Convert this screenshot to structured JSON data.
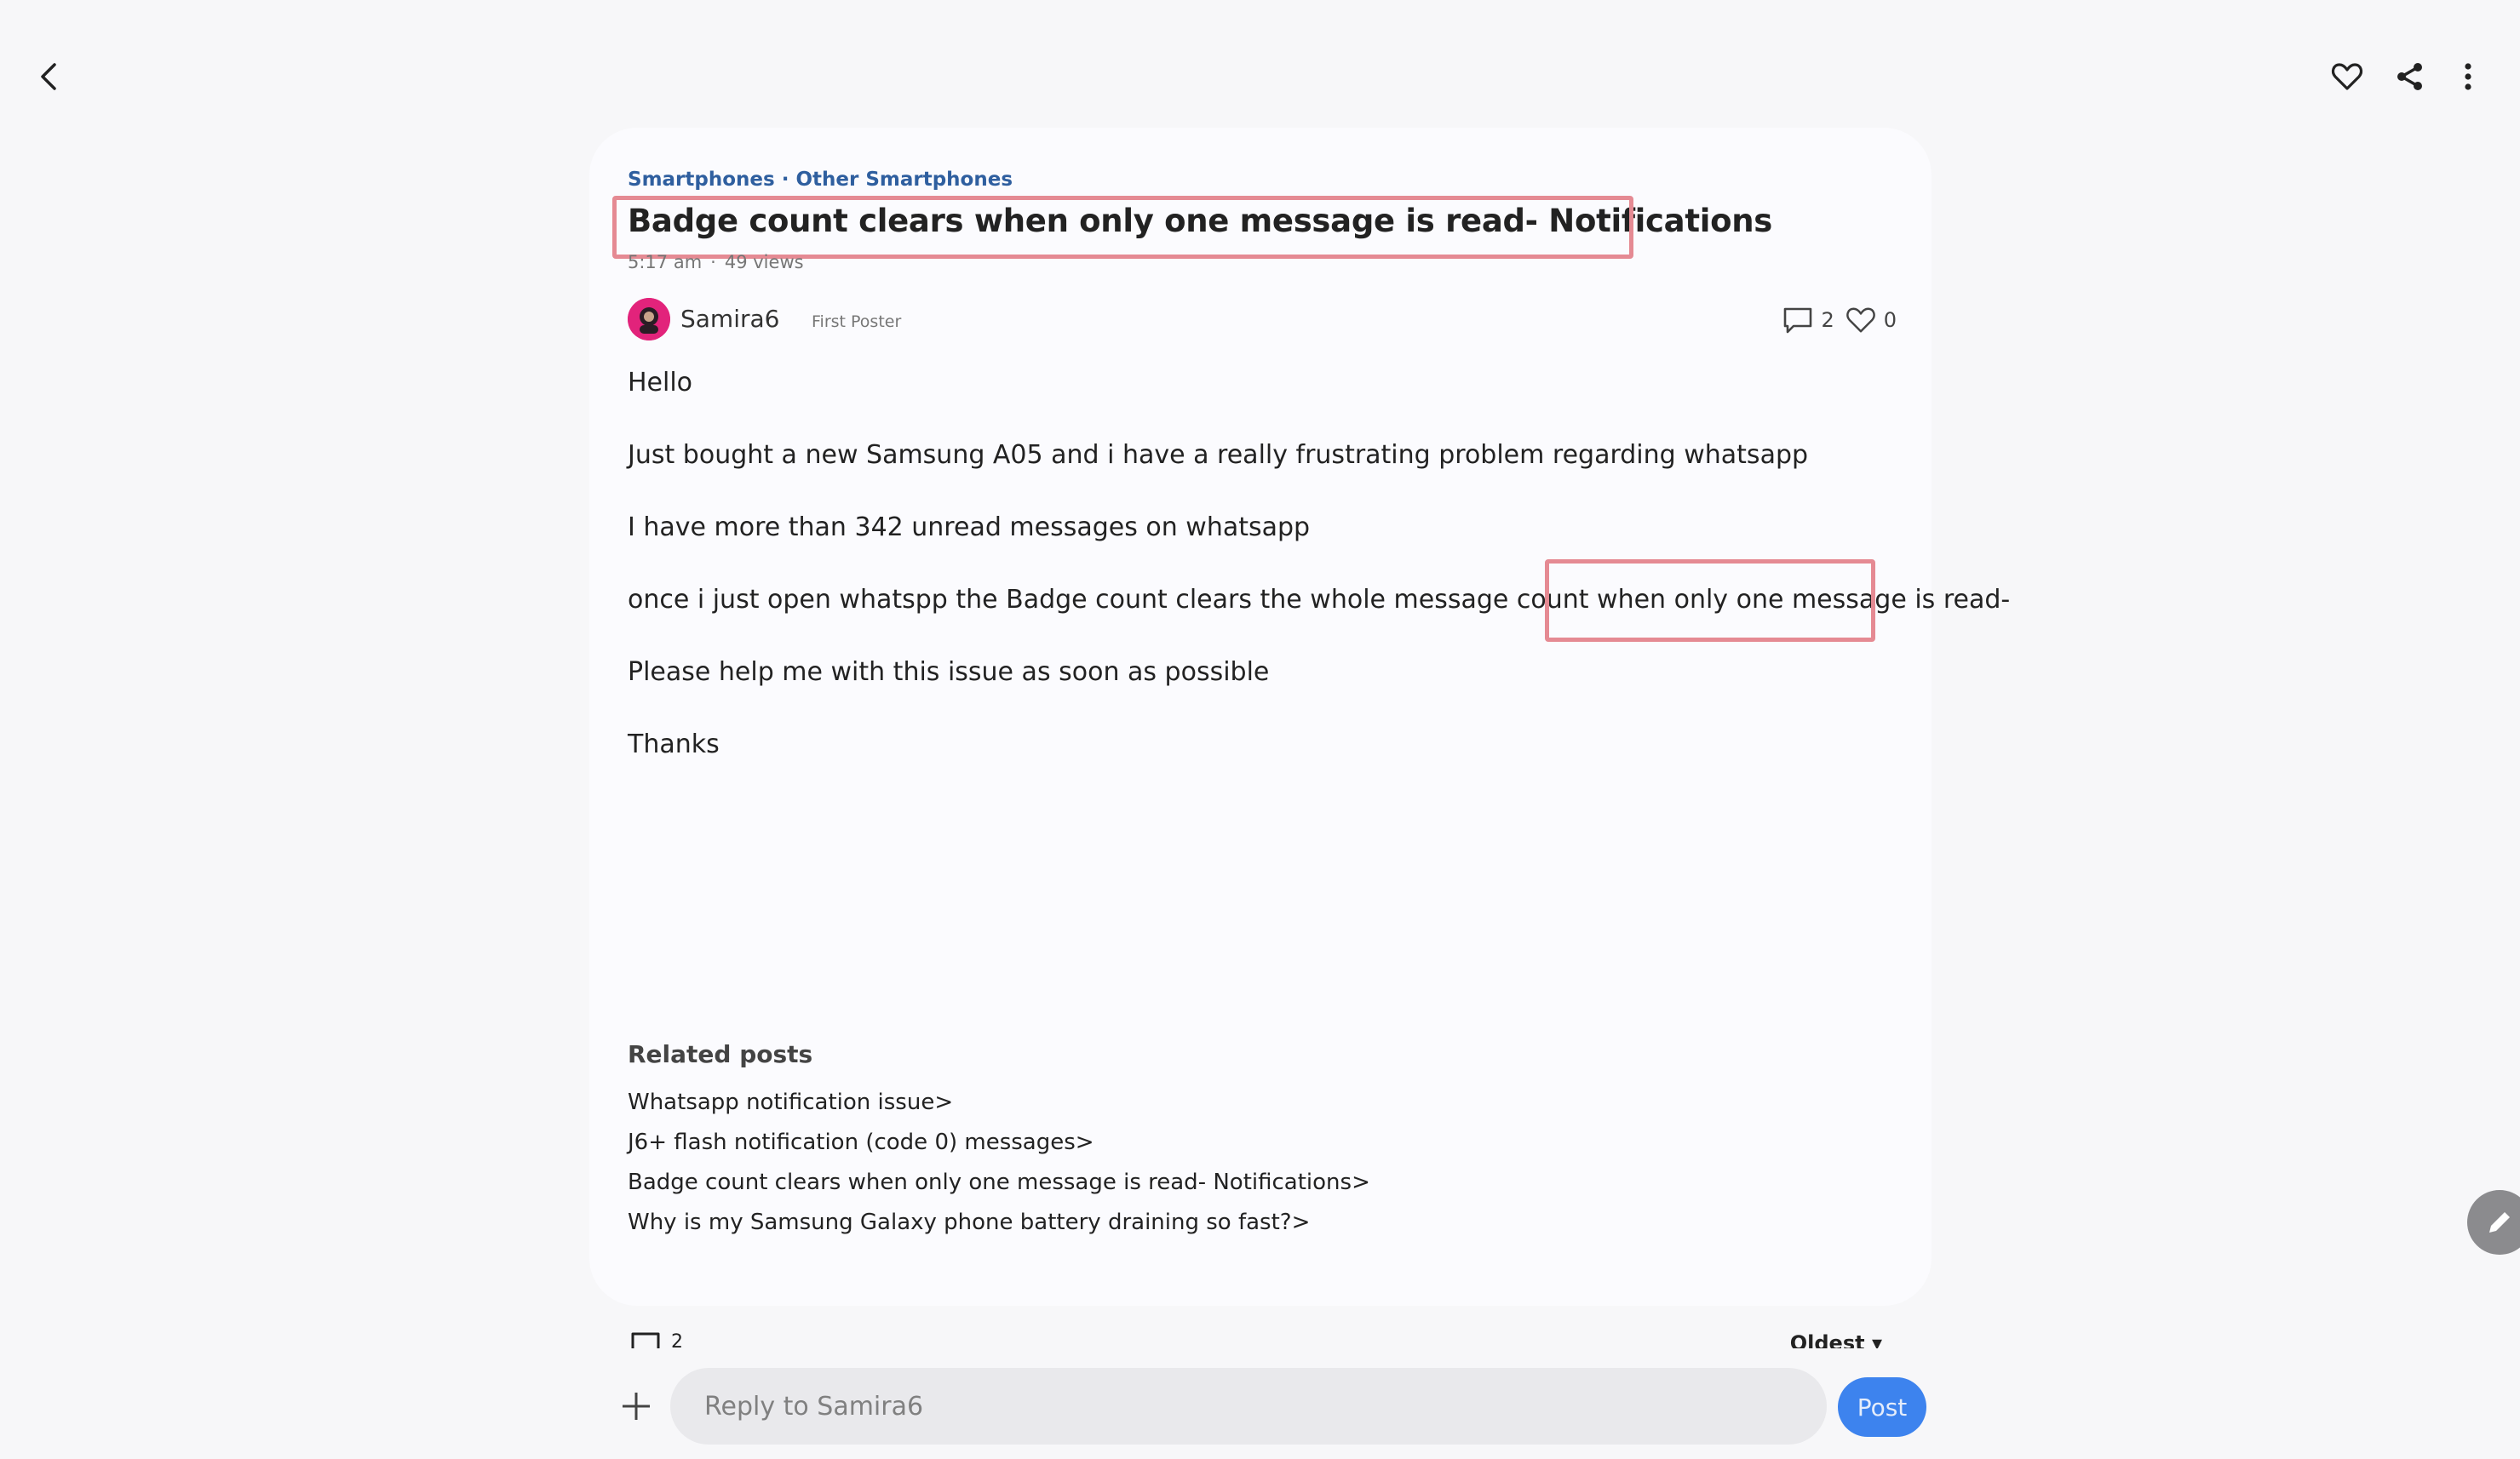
{
  "header": {
    "back_icon": "chevron-left-icon",
    "like_icon": "heart-outline-icon",
    "share_icon": "share-icon",
    "more_icon": "more-vertical-icon"
  },
  "post": {
    "breadcrumb": "Smartphones · Other Smartphones",
    "title": "Badge count clears when only one message is read- Notifications",
    "time": "5:17 am",
    "views": "49 views",
    "author": {
      "name": "Samira6",
      "rank": "First Poster"
    },
    "stats": {
      "comments": "2",
      "likes": "0"
    },
    "body": {
      "greeting": "Hello",
      "line1": "Just bought a new Samsung A05 and i have a really frustrating problem regarding whatsapp",
      "line2": "I have more than 342 unread messages on whatsapp",
      "line3": "once i just open whatspp the Badge count clears the whole message count when only one message is read-",
      "line4": "Please help me with this issue as soon as possible",
      "signoff": "Thanks"
    },
    "related": {
      "title": "Related posts",
      "items": [
        "Whatsapp notification issue>",
        "J6+ flash notification (code 0) messages>",
        "Badge count clears when only one message is read- Notifications>",
        "Why is my Samsung Galaxy phone battery draining so fast?>"
      ]
    }
  },
  "comments": {
    "count": "2",
    "sort_label": "Oldest"
  },
  "reply": {
    "placeholder": "Reply to Samira6",
    "post_label": "Post"
  },
  "colors": {
    "accent": "#3d83ee",
    "breadcrumb": "#2f5f9f",
    "highlight": "#e58a93",
    "avatar": "#e2237b"
  }
}
